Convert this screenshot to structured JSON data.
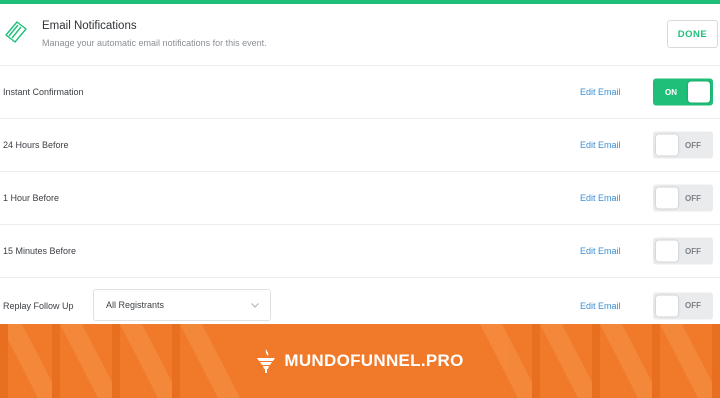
{
  "colors": {
    "accent": "#1fbf7a",
    "banner": "#f07a2a",
    "link": "#3a8fd6"
  },
  "header": {
    "title": "Email Notifications",
    "subtitle": "Manage your automatic email notifications for this event.",
    "done_label": "DONE",
    "icon": "ticket-icon"
  },
  "rows": [
    {
      "label": "Instant Confirmation",
      "edit_label": "Edit Email",
      "toggle": "ON"
    },
    {
      "label": "24 Hours Before",
      "edit_label": "Edit Email",
      "toggle": "OFF"
    },
    {
      "label": "1 Hour Before",
      "edit_label": "Edit Email",
      "toggle": "OFF"
    },
    {
      "label": "15 Minutes Before",
      "edit_label": "Edit Email",
      "toggle": "OFF"
    },
    {
      "label": "Replay Follow Up",
      "edit_label": "Edit Email",
      "toggle": "OFF",
      "audience": "All Registrants"
    }
  ],
  "banner": {
    "brand": "MUNDOFUNNEL.PRO",
    "icon": "funnel-logo-icon"
  }
}
